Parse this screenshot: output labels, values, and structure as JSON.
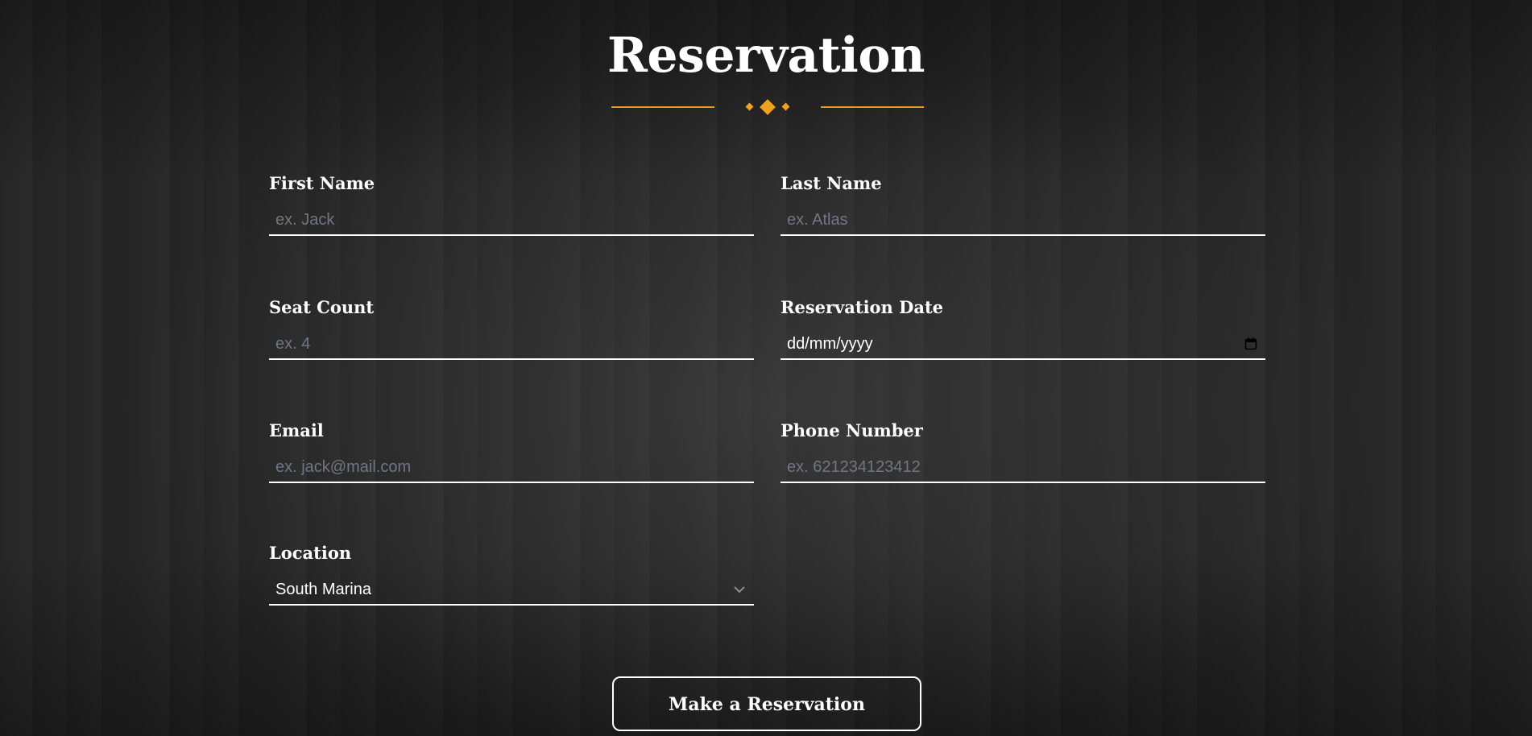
{
  "page": {
    "title": "Reservation"
  },
  "colors": {
    "accent": "#f0a21c",
    "placeholder": "#6f7784",
    "text": "#ffffff"
  },
  "form": {
    "first_name": {
      "label": "First Name",
      "placeholder": "ex. Jack",
      "value": ""
    },
    "last_name": {
      "label": "Last Name",
      "placeholder": "ex. Atlas",
      "value": ""
    },
    "seat_count": {
      "label": "Seat Count",
      "placeholder": "ex. 4",
      "value": ""
    },
    "reservation_date": {
      "label": "Reservation Date",
      "display": "dd/mm/yyyy",
      "icon": "calendar-icon"
    },
    "email": {
      "label": "Email",
      "placeholder": "ex. jack@mail.com",
      "value": ""
    },
    "phone": {
      "label": "Phone Number",
      "placeholder": "ex. 621234123412",
      "value": ""
    },
    "location": {
      "label": "Location",
      "selected": "South Marina",
      "icon": "chevron-down-icon"
    },
    "submit_label": "Make a Reservation"
  }
}
